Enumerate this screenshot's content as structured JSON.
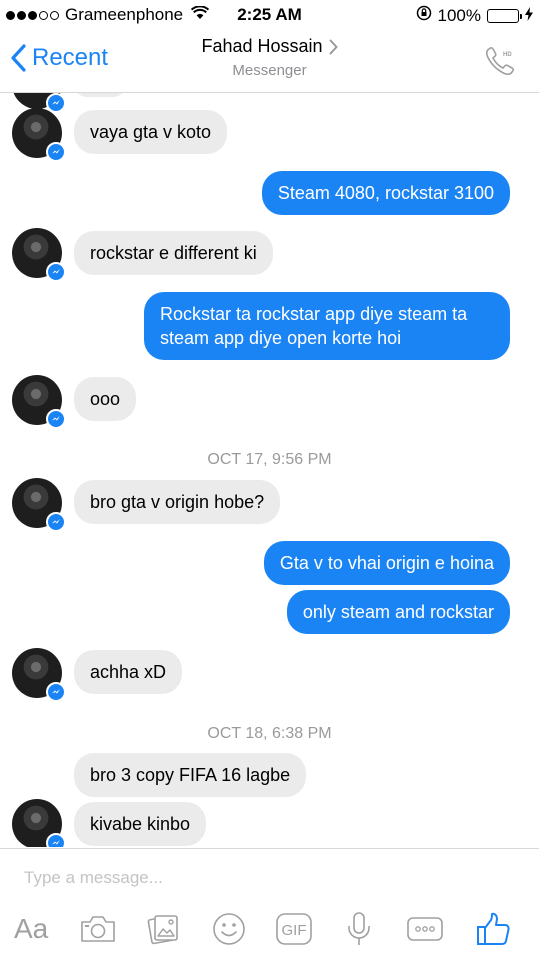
{
  "status": {
    "carrier": "Grameenphone",
    "time": "2:25 AM",
    "battery": "100%",
    "battery_level": 1.0
  },
  "nav": {
    "back_label": "Recent",
    "contact_name": "Fahad Hossain",
    "subtitle": "Messenger",
    "call_badge": "HD"
  },
  "messages": [
    {
      "from": "them",
      "text": "vaya gta v koto"
    },
    {
      "from": "me",
      "text": "Steam 4080, rockstar 3100"
    },
    {
      "from": "them",
      "text": "rockstar e different ki"
    },
    {
      "from": "me",
      "text": "Rockstar ta rockstar app diye steam ta steam app diye open korte hoi"
    },
    {
      "from": "them",
      "text": "ooo"
    },
    {
      "timestamp": "OCT 17, 9:56 PM"
    },
    {
      "from": "them",
      "text": "bro gta v origin hobe?"
    },
    {
      "from": "me",
      "text": "Gta v to vhai origin e hoina"
    },
    {
      "from": "me",
      "text": "only steam and rockstar"
    },
    {
      "from": "them",
      "text": "achha xD"
    },
    {
      "timestamp": "OCT 18, 6:38 PM"
    },
    {
      "from": "them",
      "text": "bro 3 copy FIFA 16 lagbe"
    },
    {
      "from": "them",
      "text": "kivabe kinbo"
    }
  ],
  "composer": {
    "placeholder": "Type a message...",
    "text_button": "Aa",
    "gif_label": "GIF"
  },
  "colors": {
    "accent": "#1b84f5",
    "incoming_bubble": "#ebebeb",
    "battery_green": "#4cd964",
    "icon_gray": "#a0a0a0"
  }
}
